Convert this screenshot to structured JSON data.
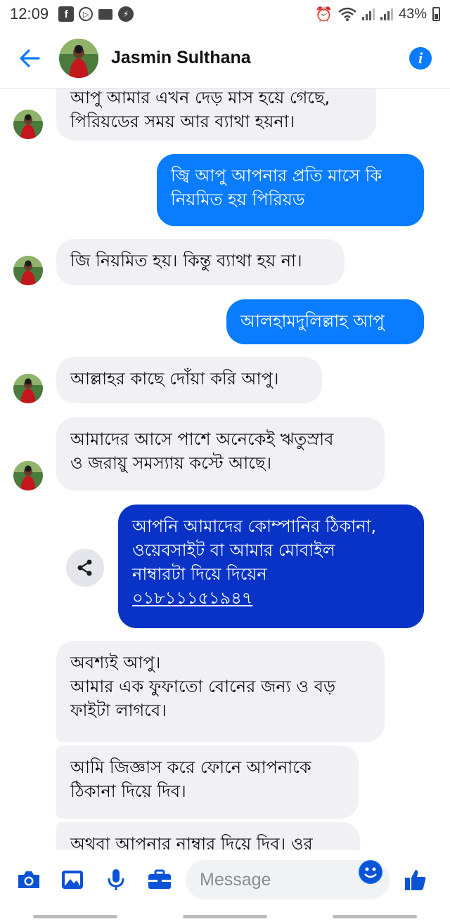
{
  "status_bar": {
    "time": "12:09",
    "battery": "43%"
  },
  "header": {
    "contact_name": "Jasmin Sulthana",
    "back_icon": "arrow-left-icon",
    "info_icon": "info-icon"
  },
  "messages": [
    {
      "direction": "incoming",
      "lines": [
        "আপু আমার এখন দেড় মাস হয়ে গেছে,",
        "পিরিয়ডের সময় আর ব্যাথা হয়না।"
      ]
    },
    {
      "direction": "outgoing",
      "lines": [
        "জ্বি আপু আপনার প্রতি মাসে কি",
        "নিয়মিত হয় পিরিয়ড"
      ]
    },
    {
      "direction": "incoming",
      "lines": [
        "জি নিয়মিত হয়। কিন্তু ব্যাথা হয় না।"
      ]
    },
    {
      "direction": "outgoing",
      "lines": [
        "আলহামদুলিল্লাহ আপু"
      ]
    },
    {
      "direction": "incoming",
      "lines": [
        "আল্লাহর কাছে দোঁয়া করি আপু।"
      ]
    },
    {
      "direction": "incoming",
      "lines": [
        "আমাদের আসে পাশে অনেকেই ঋতুস্রাব",
        "ও জরায়ু সমস্যায় কস্টে আছে।"
      ]
    },
    {
      "direction": "outgoing",
      "lines": [
        "আপনি আমাদের কোম্পানির ঠিকানা,",
        "ওয়েবসাইট  বা আমার মোবাইল",
        "নাম্বারটা দিয়ে দিয়েন"
      ],
      "link": "০১৮১১১৫১৯৪৭"
    },
    {
      "direction": "incoming",
      "lines": [
        "অবশ্যই আপু।",
        "আমার এক ফুফাতো বোনের জন্য ও বড়",
        "ফাইটা লাগবে।"
      ]
    },
    {
      "direction": "incoming",
      "lines": [
        "আমি জিজ্ঞাস করে ফোনে আপনাকে",
        "ঠিকানা দিয়ে দিব।"
      ]
    },
    {
      "direction": "incoming",
      "lines": [
        "অথবা আপনার নাম্বার দিয়ে দিব। ওর"
      ]
    }
  ],
  "composer": {
    "placeholder": "Message",
    "tools": [
      "camera-icon",
      "gallery-icon",
      "microphone-icon",
      "briefcase-icon"
    ],
    "emoji_icon": "emoji-icon",
    "like_icon": "thumbs-up-icon"
  },
  "colors": {
    "accent": "#0a7cff",
    "incoming_bubble": "#f0f0f5",
    "outgoing_bubble": "#0a7cff",
    "outgoing_bubble_dark": "#0833c6"
  }
}
